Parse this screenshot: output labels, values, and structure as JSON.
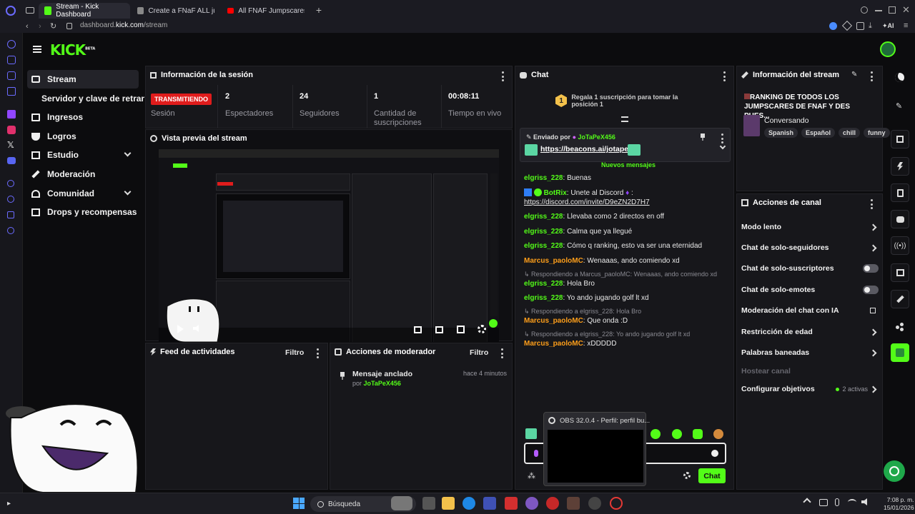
{
  "browser": {
    "tabs": [
      {
        "title": "Stream - Kick Dashboard",
        "active": true
      },
      {
        "title": "Create a FNaF ALL jumpsc",
        "active": false
      },
      {
        "title": "All FNAF Jumpscares in 10",
        "active": false
      }
    ],
    "url_prefix": "dashboard.",
    "url_domain": "kick.com",
    "url_path": "/stream",
    "ai_label": "AI"
  },
  "kick": {
    "logo": "KICK",
    "logo_badge": "BETA",
    "brand_color": "#53fc18"
  },
  "nav": {
    "items": [
      {
        "label": "Stream",
        "icon": "stream-icon",
        "active": true
      },
      {
        "label": "Servidor y clave de retransmisión",
        "icon": "",
        "active": false
      },
      {
        "label": "Ingresos",
        "icon": "revenue-icon",
        "active": false
      },
      {
        "label": "Logros",
        "icon": "trophy-icon",
        "active": false
      },
      {
        "label": "Estudio",
        "icon": "studio-icon",
        "active": false
      },
      {
        "label": "Moderación",
        "icon": "moderation-icon",
        "active": false
      },
      {
        "label": "Comunidad",
        "icon": "community-icon",
        "active": false
      },
      {
        "label": "Drops y recompensas",
        "icon": "drops-icon",
        "active": false
      }
    ]
  },
  "session": {
    "title": "Información de la sesión",
    "status": "TRANSMITIENDO",
    "status_label": "Sesión",
    "viewers": "2",
    "viewers_label": "Espectadores",
    "followers": "24",
    "followers_label": "Seguidores",
    "subs": "1",
    "subs_label": "Cantidad de suscripciones",
    "uptime": "00:08:11",
    "uptime_label": "Tiempo en vivo"
  },
  "preview": {
    "title": "Vista previa del stream"
  },
  "activity": {
    "title": "Feed de actividades",
    "filter": "Filtro"
  },
  "modactions": {
    "title": "Acciones de moderador",
    "filter": "Filtro",
    "item_title": "Mensaje anclado",
    "item_time": "hace 4 minutos",
    "item_by": "por",
    "item_user": "JoTaPeX456"
  },
  "chat": {
    "title": "Chat",
    "gift_rank": "1",
    "gift_text": "Regala 1 suscripción para tomar la posición 1",
    "pinned_by_label": "Enviado por",
    "pinned_user": "JoTaPeX456",
    "pinned_link": "https://beacons.ai/jotapex",
    "new_messages": "Nuevos mensajes",
    "messages": [
      {
        "user": "elgriss_228",
        "color": "green",
        "text": "Buenas"
      },
      {
        "user": "BotRix",
        "color": "green",
        "text": "Unete al Discord",
        "link": "https://discord.com/invite/D9eZN2D7H7"
      },
      {
        "user": "elgriss_228",
        "color": "green",
        "text": "Llevaba como 2 directos en off"
      },
      {
        "user": "elgriss_228",
        "color": "green",
        "text": "Calma que ya llegué"
      },
      {
        "user": "elgriss_228",
        "color": "green",
        "text": "Cómo q ranking, esto va ser una eternidad"
      },
      {
        "user": "Marcus_paoloMC",
        "color": "orange",
        "text": "Wenaaas, ando comiendo xd"
      },
      {
        "reply": "Respondiendo a Marcus_paoloMC: Wenaaas, ando comiendo xd",
        "user": "elgriss_228",
        "color": "green",
        "text": "Hola Bro"
      },
      {
        "user": "elgriss_228",
        "color": "green",
        "text": "Yo ando jugando golf lt xd"
      },
      {
        "reply": "Respondiendo a elgriss_228: Hola Bro",
        "user": "Marcus_paoloMC",
        "color": "orange",
        "text": "Que onda :D"
      },
      {
        "reply": "Respondiendo a elgriss_228: Yo ando jugando golf lt xd",
        "user": "Marcus_paoloMC",
        "color": "orange",
        "text": "xDDDDD"
      }
    ],
    "send_label": "Chat"
  },
  "streaminfo": {
    "title": "Información del stream",
    "stream_title": "RANKING DE TODOS LOS JUMPSCARES DE FNAF Y DES PUES...",
    "category": "Conversando",
    "tags": [
      "Spanish",
      "Español",
      "chill",
      "funny"
    ]
  },
  "channel_actions": {
    "title": "Acciones de canal",
    "items": [
      {
        "label": "Modo lento",
        "control": "chevron"
      },
      {
        "label": "Chat de solo-seguidores",
        "control": "chevron"
      },
      {
        "label": "Chat de solo-suscriptores",
        "control": "toggle"
      },
      {
        "label": "Chat de solo-emotes",
        "control": "toggle"
      },
      {
        "label": "Moderación del chat con IA",
        "control": "external"
      },
      {
        "label": "Restricción de edad",
        "control": "chevron"
      },
      {
        "label": "Palabras baneadas",
        "control": "chevron"
      },
      {
        "label": "Hostear canal",
        "control": "none",
        "disabled": true
      },
      {
        "label": "Configurar objetivos",
        "control": "chevron",
        "extra": "2 activas"
      }
    ]
  },
  "obs_tooltip": "OBS 32.0.4 - Perfil: perfil bu...",
  "taskbar": {
    "search_placeholder": "Búsqueda",
    "time": "7:08 p. m.",
    "date": "15/01/2026"
  }
}
